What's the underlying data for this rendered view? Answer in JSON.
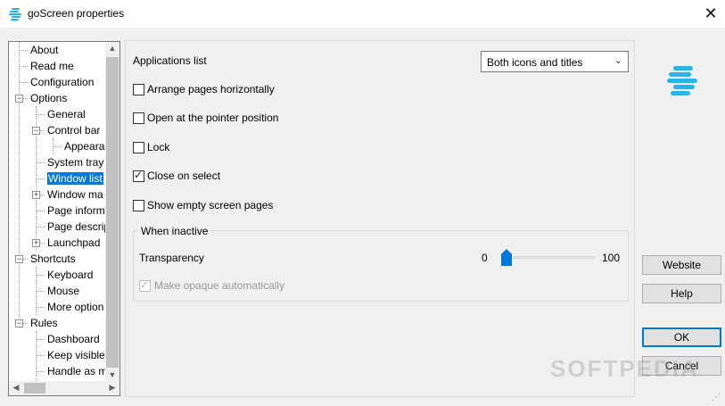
{
  "window": {
    "title": "goScreen properties",
    "close_glyph": "✕"
  },
  "tree": {
    "items": [
      {
        "label": "About"
      },
      {
        "label": "Read me"
      },
      {
        "label": "Configuration"
      },
      {
        "label": "Options",
        "expander": "−"
      },
      {
        "label": "General"
      },
      {
        "label": "Control bar",
        "expander": "−"
      },
      {
        "label": "Appearan"
      },
      {
        "label": "System tray"
      },
      {
        "label": "Window list",
        "selected": true
      },
      {
        "label": "Window ma",
        "expander": "+"
      },
      {
        "label": "Page inform"
      },
      {
        "label": "Page descrip"
      },
      {
        "label": "Launchpad",
        "expander": "+"
      },
      {
        "label": "Shortcuts",
        "expander": "−"
      },
      {
        "label": "Keyboard"
      },
      {
        "label": "Mouse"
      },
      {
        "label": "More option"
      },
      {
        "label": "Rules",
        "expander": "−"
      },
      {
        "label": "Dashboard"
      },
      {
        "label": "Keep visible"
      },
      {
        "label": "Handle as m"
      }
    ]
  },
  "settings": {
    "applications_list_label": "Applications list",
    "applications_list_value": "Both icons and titles",
    "checkboxes": [
      {
        "label": "Arrange pages horizontally",
        "checked": false
      },
      {
        "label": "Open at the pointer position",
        "checked": false
      },
      {
        "label": "Lock",
        "checked": false
      },
      {
        "label": "Close on select",
        "checked": true
      },
      {
        "label": "Show empty screen pages",
        "checked": false
      }
    ],
    "inactive_group": {
      "title": "When inactive",
      "transparency_label": "Transparency",
      "min": "0",
      "max": "100",
      "value": 0,
      "make_opaque_label": "Make opaque automatically",
      "make_opaque_checked": true,
      "make_opaque_enabled": false
    }
  },
  "buttons": {
    "website": "Website",
    "help": "Help",
    "ok": "OK",
    "cancel": "Cancel"
  },
  "watermark": "SOFTPEDIA",
  "colors": {
    "accent": "#0078d7",
    "logo": "#25b6e8"
  }
}
